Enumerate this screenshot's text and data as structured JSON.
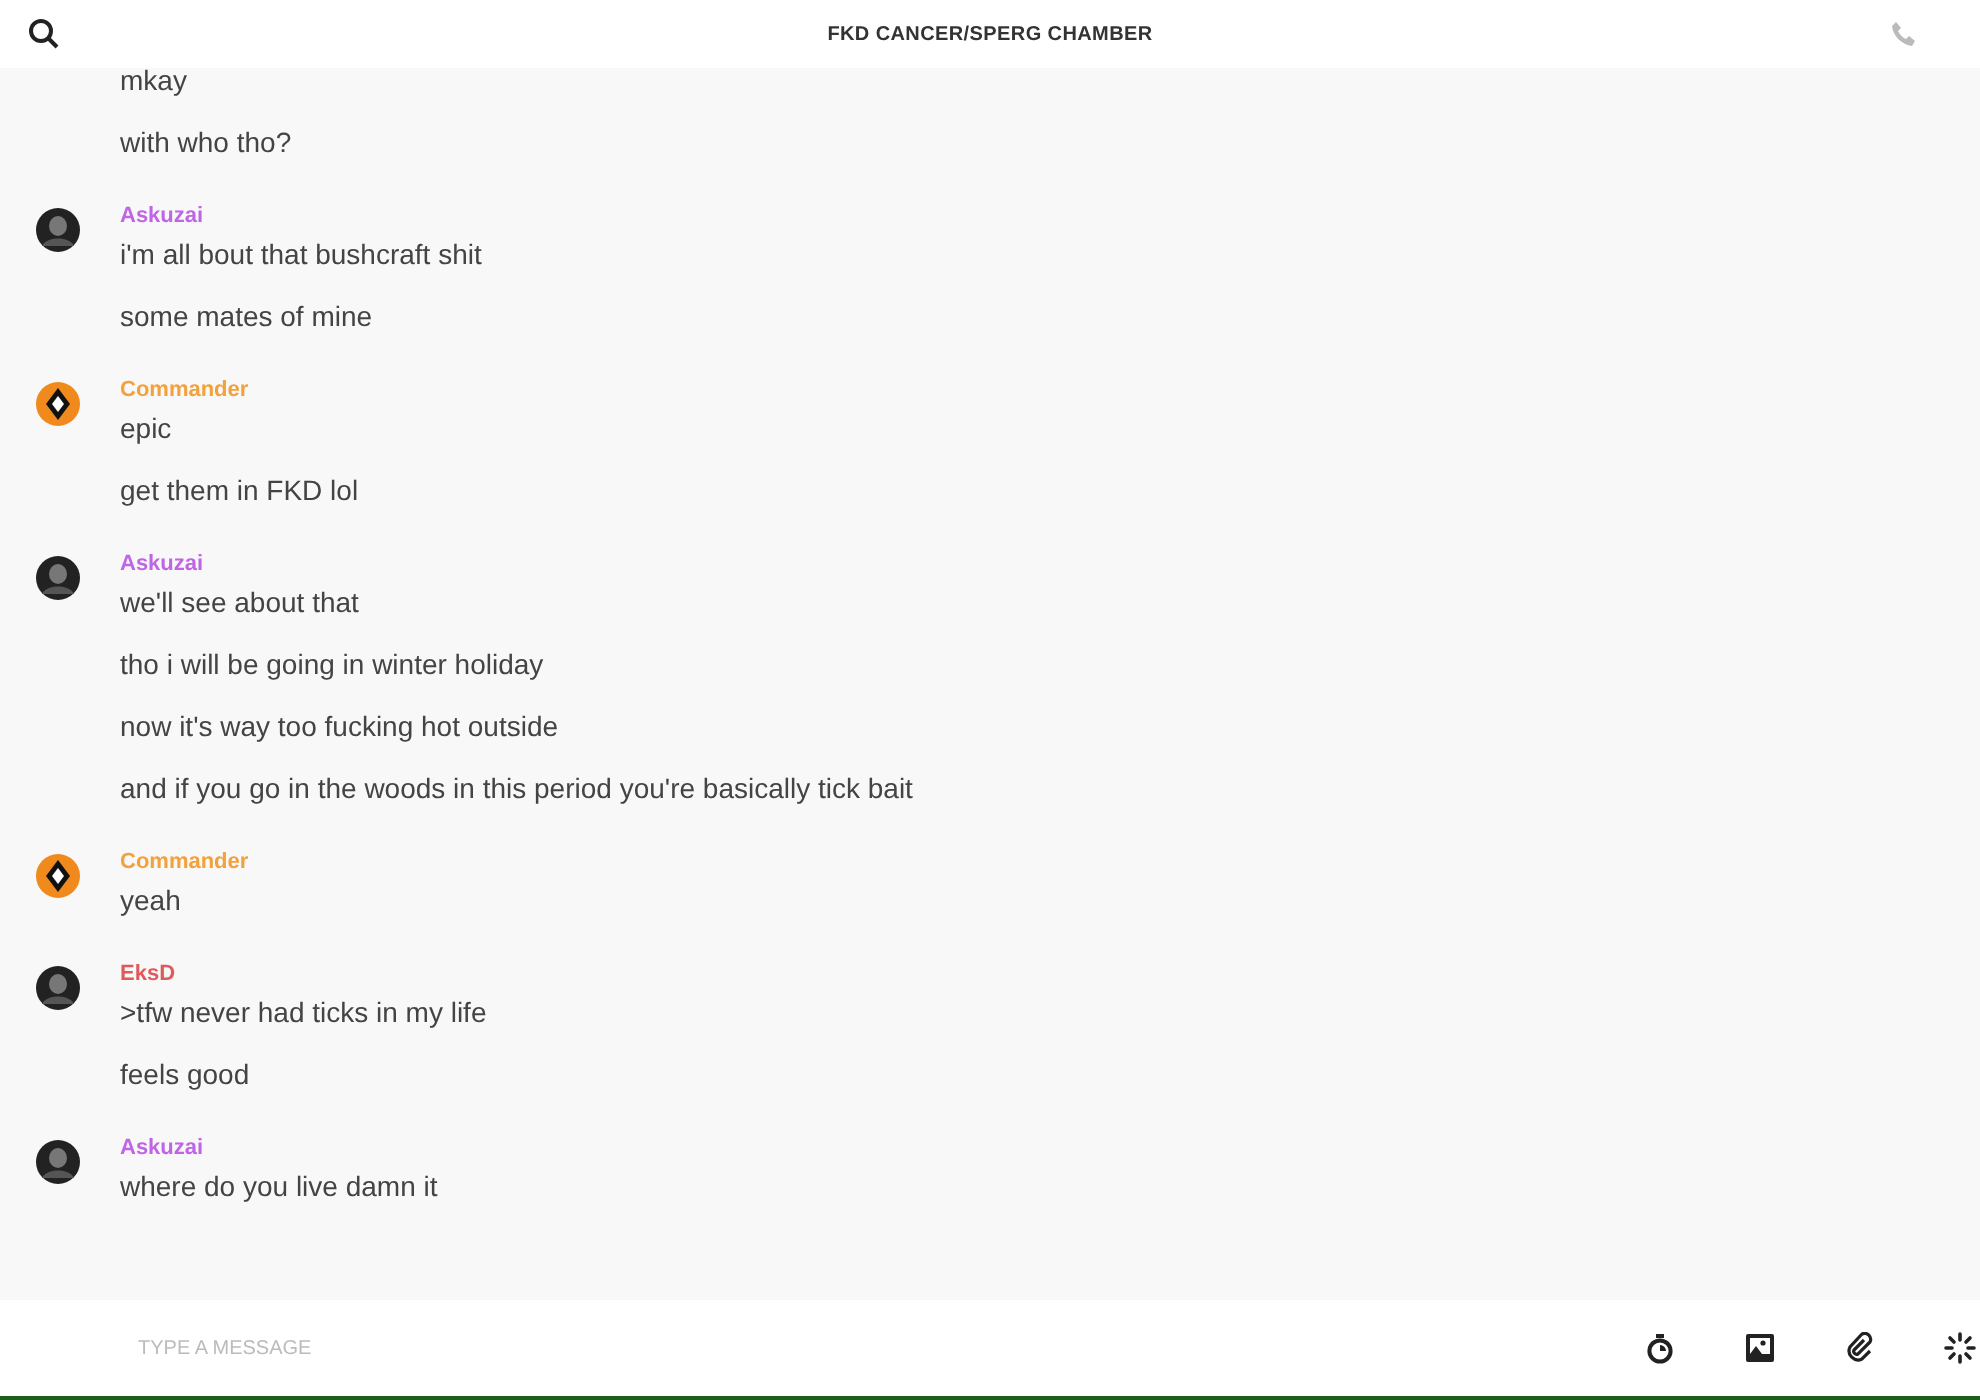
{
  "header": {
    "title": "FKD CANCER/SPERG CHAMBER"
  },
  "groups": [
    {
      "messages": [
        "mkay",
        "with who tho?"
      ]
    },
    {
      "author": "Askuzai",
      "color": "#c065e6",
      "avatar": {
        "kind": "dark"
      },
      "messages": [
        "i'm all bout that bushcraft shit",
        "some mates of mine"
      ]
    },
    {
      "author": "Commander",
      "color": "#f3a13c",
      "avatar": {
        "kind": "diamond"
      },
      "messages": [
        "epic",
        "get them in FKD lol"
      ]
    },
    {
      "author": "Askuzai",
      "color": "#c065e6",
      "avatar": {
        "kind": "dark"
      },
      "messages": [
        "we'll see about that",
        "tho i will be going in winter holiday",
        "now it's way too fucking hot outside",
        "and if you go in the woods in this period you're basically tick bait"
      ]
    },
    {
      "author": "Commander",
      "color": "#f3a13c",
      "avatar": {
        "kind": "diamond"
      },
      "messages": [
        "yeah"
      ]
    },
    {
      "author": "EksD",
      "color": "#e0595b",
      "avatar": {
        "kind": "dark"
      },
      "messages": [
        ">tfw never had ticks in my life",
        "feels good"
      ]
    },
    {
      "author": "Askuzai",
      "color": "#c065e6",
      "avatar": {
        "kind": "dark"
      },
      "messages": [
        "where do you live damn it"
      ]
    }
  ],
  "composer": {
    "placeholder": "TYPE A MESSAGE"
  }
}
